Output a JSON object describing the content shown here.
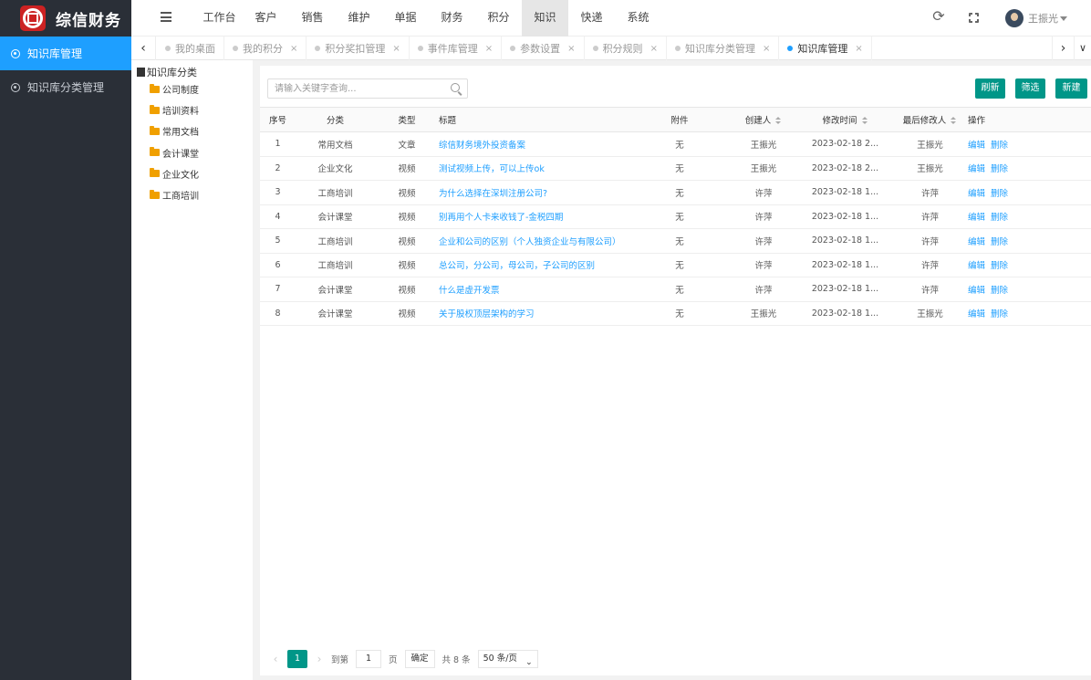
{
  "app": {
    "name": "综信财务",
    "username": "王振光"
  },
  "topnav": [
    {
      "label": "工作台",
      "active": false
    },
    {
      "label": "客户",
      "active": false
    },
    {
      "label": "销售",
      "active": false
    },
    {
      "label": "维护",
      "active": false
    },
    {
      "label": "单据",
      "active": false
    },
    {
      "label": "财务",
      "active": false
    },
    {
      "label": "积分",
      "active": false
    },
    {
      "label": "知识",
      "active": true
    },
    {
      "label": "快递",
      "active": false
    },
    {
      "label": "系统",
      "active": false
    }
  ],
  "sidebar": [
    {
      "label": "知识库管理",
      "active": true
    },
    {
      "label": "知识库分类管理",
      "active": false
    }
  ],
  "tabs": [
    {
      "label": "我的桌面",
      "active": false,
      "closable": false
    },
    {
      "label": "我的积分",
      "active": false,
      "closable": true
    },
    {
      "label": "积分奖扣管理",
      "active": false,
      "closable": true
    },
    {
      "label": "事件库管理",
      "active": false,
      "closable": true
    },
    {
      "label": "参数设置",
      "active": false,
      "closable": true
    },
    {
      "label": "积分规则",
      "active": false,
      "closable": true
    },
    {
      "label": "知识库分类管理",
      "active": false,
      "closable": true
    },
    {
      "label": "知识库管理",
      "active": true,
      "closable": true
    }
  ],
  "tree": {
    "root": "知识库分类",
    "nodes": [
      "公司制度",
      "培训资料",
      "常用文档",
      "会计课堂",
      "企业文化",
      "工商培训"
    ]
  },
  "search": {
    "placeholder": "请输入关键字查询..."
  },
  "toolbar": {
    "refresh": "刷新",
    "filter": "筛选",
    "new": "新建"
  },
  "table": {
    "headers": {
      "no": "序号",
      "category": "分类",
      "type": "类型",
      "title": "标题",
      "attachment": "附件",
      "creator": "创建人",
      "modified": "修改时间",
      "last_modifier": "最后修改人",
      "ops": "操作"
    },
    "rows": [
      {
        "no": "1",
        "category": "常用文档",
        "type": "文章",
        "title": "综信财务境外投资备案",
        "attachment": "无",
        "creator": "王振光",
        "modified": "2023-02-18 2...",
        "last_modifier": "王振光"
      },
      {
        "no": "2",
        "category": "企业文化",
        "type": "视频",
        "title": "测试视频上传，可以上传ok",
        "attachment": "无",
        "creator": "王振光",
        "modified": "2023-02-18 2...",
        "last_modifier": "王振光"
      },
      {
        "no": "3",
        "category": "工商培训",
        "type": "视频",
        "title": "为什么选择在深圳注册公司?",
        "attachment": "无",
        "creator": "许萍",
        "modified": "2023-02-18 1...",
        "last_modifier": "许萍"
      },
      {
        "no": "4",
        "category": "会计课堂",
        "type": "视频",
        "title": "别再用个人卡来收钱了-金税四期",
        "attachment": "无",
        "creator": "许萍",
        "modified": "2023-02-18 1...",
        "last_modifier": "许萍"
      },
      {
        "no": "5",
        "category": "工商培训",
        "type": "视频",
        "title": "企业和公司的区别（个人独资企业与有限公司）",
        "attachment": "无",
        "creator": "许萍",
        "modified": "2023-02-18 1...",
        "last_modifier": "许萍"
      },
      {
        "no": "6",
        "category": "工商培训",
        "type": "视频",
        "title": "总公司，分公司，母公司，子公司的区别",
        "attachment": "无",
        "creator": "许萍",
        "modified": "2023-02-18 1...",
        "last_modifier": "许萍"
      },
      {
        "no": "7",
        "category": "会计课堂",
        "type": "视频",
        "title": "什么是虚开发票",
        "attachment": "无",
        "creator": "许萍",
        "modified": "2023-02-18 1...",
        "last_modifier": "许萍"
      },
      {
        "no": "8",
        "category": "会计课堂",
        "type": "视频",
        "title": "关于股权顶层架构的学习",
        "attachment": "无",
        "creator": "王振光",
        "modified": "2023-02-18 1...",
        "last_modifier": "王振光"
      }
    ],
    "ops": {
      "edit": "编辑",
      "delete": "删除"
    }
  },
  "pager": {
    "current": "1",
    "goto_label": "到第",
    "page_input": "1",
    "page_unit": "页",
    "confirm": "确定",
    "total": "共 8 条",
    "page_size": "50 条/页"
  },
  "colors": {
    "sidebar_bg": "#2a2f37",
    "sidebar_active": "#1e9fff",
    "primary_button": "#009688",
    "link": "#1e9fff",
    "folder": "#f0a000"
  }
}
